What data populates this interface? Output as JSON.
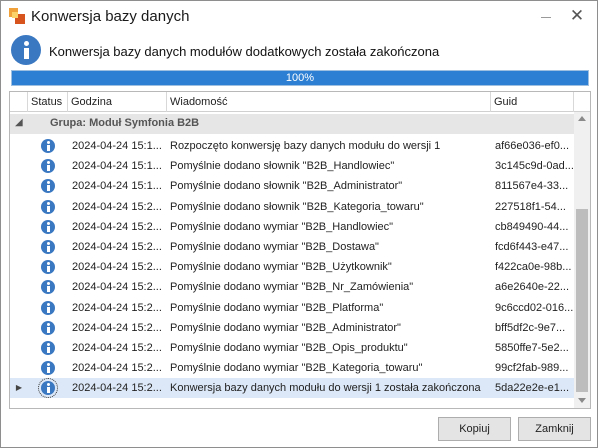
{
  "window": {
    "title": "Konwersja bazy danych"
  },
  "header": {
    "message": "Konwersja bazy danych modułów dodatkowych została zakończona"
  },
  "progress": {
    "value": 1.0,
    "label": "100%"
  },
  "grid": {
    "columns": [
      "Status",
      "Godzina",
      "Wiadomość",
      "Guid"
    ],
    "group_label": "Grupa: Moduł Symfonia B2B",
    "rows": [
      {
        "status": "info-icon",
        "godzina": "2024-04-24 15:1...",
        "wiadomosc": "Rozpoczęto konwersję bazy danych modułu do wersji 1",
        "guid": "af66e036-ef0..."
      },
      {
        "status": "info-icon",
        "godzina": "2024-04-24 15:1...",
        "wiadomosc": "Pomyślnie dodano słownik  \"B2B_Handlowiec\"",
        "guid": "3c145c9d-0ad..."
      },
      {
        "status": "info-icon",
        "godzina": "2024-04-24 15:1...",
        "wiadomosc": "Pomyślnie dodano słownik  \"B2B_Administrator\"",
        "guid": "811567e4-33..."
      },
      {
        "status": "info-icon",
        "godzina": "2024-04-24 15:2...",
        "wiadomosc": "Pomyślnie dodano słownik  \"B2B_Kategoria_towaru\"",
        "guid": "227518f1-54..."
      },
      {
        "status": "info-icon",
        "godzina": "2024-04-24 15:2...",
        "wiadomosc": "Pomyślnie dodano wymiar  \"B2B_Handlowiec\"",
        "guid": "cb849490-44..."
      },
      {
        "status": "info-icon",
        "godzina": "2024-04-24 15:2...",
        "wiadomosc": "Pomyślnie dodano wymiar  \"B2B_Dostawa\"",
        "guid": "fcd6f443-e47..."
      },
      {
        "status": "info-icon",
        "godzina": "2024-04-24 15:2...",
        "wiadomosc": "Pomyślnie dodano wymiar  \"B2B_Użytkownik\"",
        "guid": "f422ca0e-98b..."
      },
      {
        "status": "info-icon",
        "godzina": "2024-04-24 15:2...",
        "wiadomosc": "Pomyślnie dodano wymiar  \"B2B_Nr_Zamówienia\"",
        "guid": "a6e2640e-22..."
      },
      {
        "status": "info-icon",
        "godzina": "2024-04-24 15:2...",
        "wiadomosc": "Pomyślnie dodano wymiar  \"B2B_Platforma\"",
        "guid": "9c6ccd02-016..."
      },
      {
        "status": "info-icon",
        "godzina": "2024-04-24 15:2...",
        "wiadomosc": "Pomyślnie dodano wymiar  \"B2B_Administrator\"",
        "guid": "bff5df2c-9e7..."
      },
      {
        "status": "info-icon",
        "godzina": "2024-04-24 15:2...",
        "wiadomosc": "Pomyślnie dodano wymiar  \"B2B_Opis_produktu\"",
        "guid": "5850ffe7-5e2..."
      },
      {
        "status": "info-icon",
        "godzina": "2024-04-24 15:2...",
        "wiadomosc": "Pomyślnie dodano wymiar  \"B2B_Kategoria_towaru\"",
        "guid": "99cf2fab-989..."
      },
      {
        "status": "info-icon",
        "godzina": "2024-04-24 15:2...",
        "wiadomosc": "Konwersja bazy danych modułu do wersji 1 została zakończona",
        "guid": "5da22e2e-e1...",
        "focused": true
      }
    ]
  },
  "buttons": {
    "copy": "Kopiuj",
    "close": "Zamknij"
  },
  "colors": {
    "accent": "#2c7fd3",
    "focused_row": "#dce8f7",
    "group_bg": "#e6e6e6",
    "info_icon": "#3a78c2"
  }
}
